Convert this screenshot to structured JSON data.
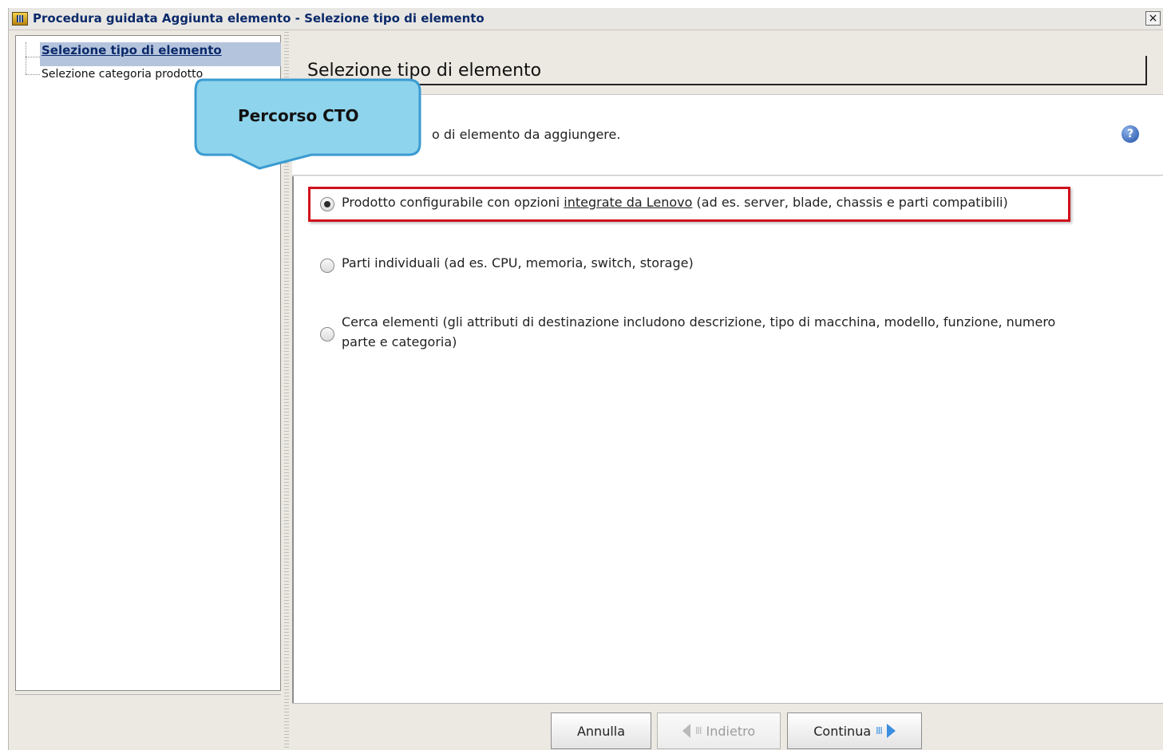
{
  "window": {
    "title": "Procedura guidata Aggiunta elemento - Selezione tipo di elemento",
    "close_label": "×"
  },
  "sidebar": {
    "items": [
      {
        "label": "Selezione tipo di elemento",
        "selected": true
      },
      {
        "label": "Selezione categoria prodotto",
        "selected": false
      }
    ]
  },
  "main": {
    "title": "Selezione tipo di elemento",
    "description_visible": "o di elemento da aggiungere.",
    "help_icon": "question-icon",
    "options": [
      {
        "checked": true,
        "text_before": "Prodotto configurabile con opzioni ",
        "text_link": "integrate da Lenovo",
        "text_after": " (ad es. server, blade, chassis e parti compatibili)"
      },
      {
        "checked": false,
        "text": "Parti individuali (ad es. CPU, memoria, switch, storage)"
      },
      {
        "checked": false,
        "text_line1": "Cerca elementi (gli attributi di destinazione includono descrizione, tipo di macchina, modello, funzione, numero",
        "text_line2": "parte e categoria)"
      }
    ]
  },
  "buttons": {
    "cancel": "Annulla",
    "back": "Indietro",
    "continue": "Continua"
  },
  "callout": {
    "text": "Percorso CTO",
    "fill": "#8ed4ec",
    "border": "#3a9bd1"
  },
  "highlight_color": "#d0101b"
}
